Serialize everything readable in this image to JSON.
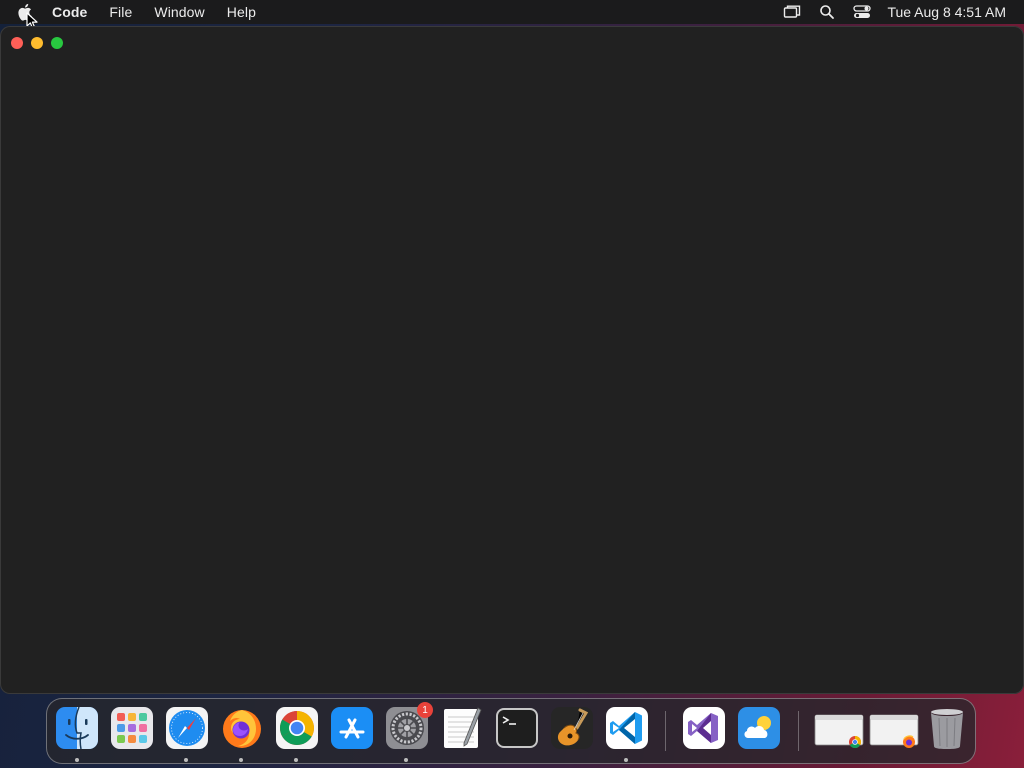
{
  "menubar": {
    "app_name": "Code",
    "menus": [
      "File",
      "Window",
      "Help"
    ],
    "clock": "Tue Aug 8  4:51 AM"
  },
  "window": {
    "title": ""
  },
  "dock": {
    "apps": [
      {
        "name": "Finder",
        "icon": "finder-icon",
        "running": true
      },
      {
        "name": "Launchpad",
        "icon": "launchpad-icon",
        "running": false
      },
      {
        "name": "Safari",
        "icon": "safari-icon",
        "running": true
      },
      {
        "name": "Firefox",
        "icon": "firefox-icon",
        "running": true
      },
      {
        "name": "Google Chrome",
        "icon": "chrome-icon",
        "running": true
      },
      {
        "name": "App Store",
        "icon": "app-store-icon",
        "running": false
      },
      {
        "name": "System Settings",
        "icon": "settings-icon",
        "running": true,
        "badge": "1"
      },
      {
        "name": "TextEdit",
        "icon": "textedit-icon",
        "running": false
      },
      {
        "name": "Terminal",
        "icon": "terminal-icon",
        "running": false
      },
      {
        "name": "GarageBand",
        "icon": "garageband-icon",
        "running": false
      },
      {
        "name": "Visual Studio Code",
        "icon": "vscode-icon",
        "running": true
      }
    ],
    "recent_apps": [
      {
        "name": "Visual Studio",
        "icon": "visual-studio-icon"
      },
      {
        "name": "Weather",
        "icon": "weather-icon"
      }
    ],
    "minimized": [
      {
        "name": "Chrome window",
        "icon": "chrome-window-thumbnail"
      },
      {
        "name": "Firefox window",
        "icon": "firefox-window-thumbnail"
      }
    ],
    "trash": {
      "name": "Trash",
      "icon": "trash-icon"
    }
  },
  "colors": {
    "close": "#fe5f57",
    "minimize": "#febc2e",
    "zoom": "#28c840",
    "window_bg": "#212121",
    "menubar_bg": "#1b1b1c"
  }
}
